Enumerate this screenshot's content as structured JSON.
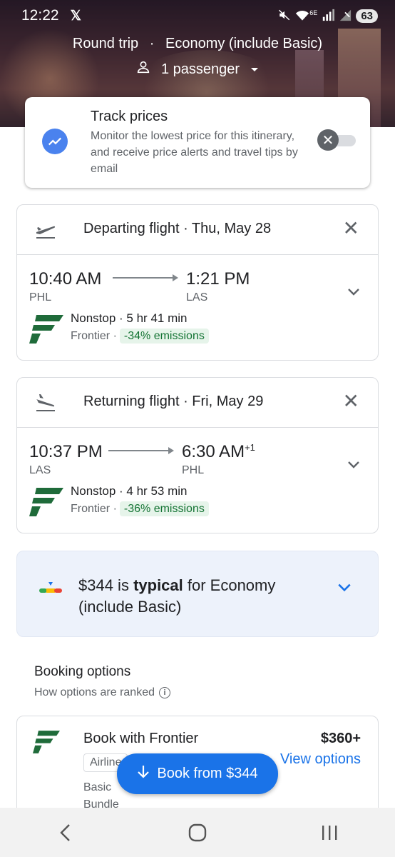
{
  "status": {
    "time": "12:22",
    "x_logo": "𝕏",
    "network": "6E",
    "battery": "63"
  },
  "trip": {
    "trip_type": "Round trip",
    "cabin": "Economy (include Basic)",
    "passengers": "1 passenger"
  },
  "track": {
    "title": "Track prices",
    "description": "Monitor the lowest price for this itinerary, and receive price alerts and travel tips by email",
    "enabled": false
  },
  "departing": {
    "title": "Departing flight · Thu, May 28",
    "depart_time": "10:40 AM",
    "depart_code": "PHL",
    "arrive_time": "1:21 PM",
    "arrive_code": "LAS",
    "day_offset": "",
    "stops": "Nonstop · 5 hr 41 min",
    "airline": "Frontier ·",
    "emissions": "-34% emissions"
  },
  "returning": {
    "title": "Returning flight · Fri, May 29",
    "depart_time": "10:37 PM",
    "depart_code": "LAS",
    "arrive_time": "6:30 AM",
    "arrive_code": "PHL",
    "day_offset": "+1",
    "stops": "Nonstop · 4 hr 53 min",
    "airline": "Frontier ·",
    "emissions": "-36% emissions"
  },
  "insight": {
    "price": "$344 is ",
    "level": "typical",
    "rest": " for Economy (include Basic)"
  },
  "booking": {
    "title": "Booking options",
    "subtitle": "How options are ranked",
    "option": {
      "name": "Book with Frontier",
      "price": "$360+",
      "view": "View options",
      "chip": "Airline",
      "fare_line1": "Basic",
      "fare_line2": "Bundle"
    }
  },
  "fab": {
    "label": "Book from $344"
  },
  "colors": {
    "accent": "#1a73e8",
    "frontier_green": "#1f6b3a",
    "emissions_bg": "#e6f4ea"
  }
}
